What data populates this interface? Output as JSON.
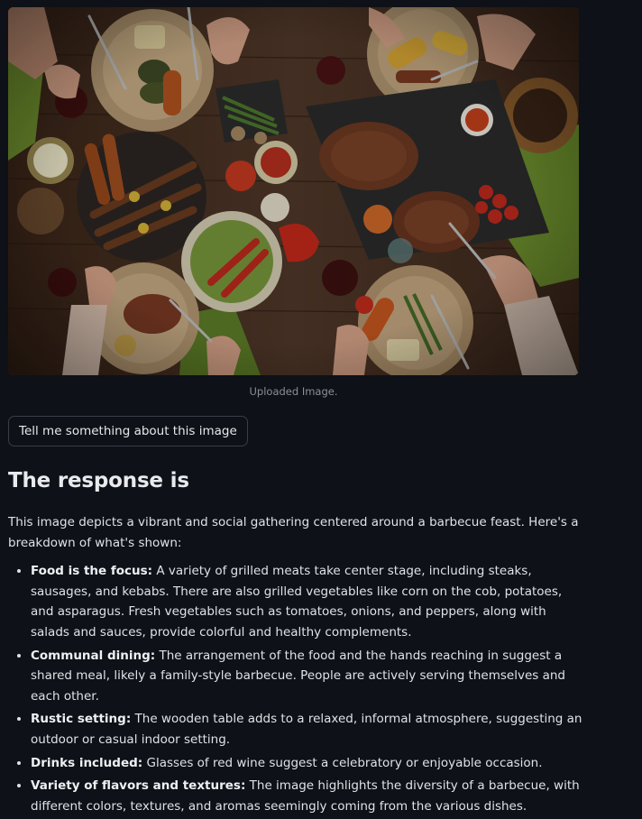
{
  "image": {
    "caption": "Uploaded Image.",
    "subject": "barbecue feast on wooden table"
  },
  "prompt_button": {
    "label": "Tell me something about this image"
  },
  "response": {
    "heading": "The response is",
    "intro": "This image depicts a vibrant and social gathering centered around a barbecue feast. Here's a breakdown of what's shown:",
    "bullets": [
      {
        "term": "Food is the focus:",
        "text": " A variety of grilled meats take center stage, including steaks, sausages, and kebabs. There are also grilled vegetables like corn on the cob, potatoes, and asparagus. Fresh vegetables such as tomatoes, onions, and peppers, along with salads and sauces, provide colorful and healthy complements."
      },
      {
        "term": "Communal dining:",
        "text": " The arrangement of the food and the hands reaching in suggest a shared meal, likely a family-style barbecue. People are actively serving themselves and each other."
      },
      {
        "term": "Rustic setting:",
        "text": " The wooden table adds to a relaxed, informal atmosphere, suggesting an outdoor or casual indoor setting."
      },
      {
        "term": "Drinks included:",
        "text": " Glasses of red wine suggest a celebratory or enjoyable occasion."
      },
      {
        "term": "Variety of flavors and textures:",
        "text": " The image highlights the diversity of a barbecue, with different colors, textures, and aromas seemingly coming from the various dishes."
      }
    ]
  },
  "colors": {
    "background": "#0e1117",
    "text": "#e6e8ec",
    "muted": "#8b8f98",
    "border": "#3a3d47"
  }
}
